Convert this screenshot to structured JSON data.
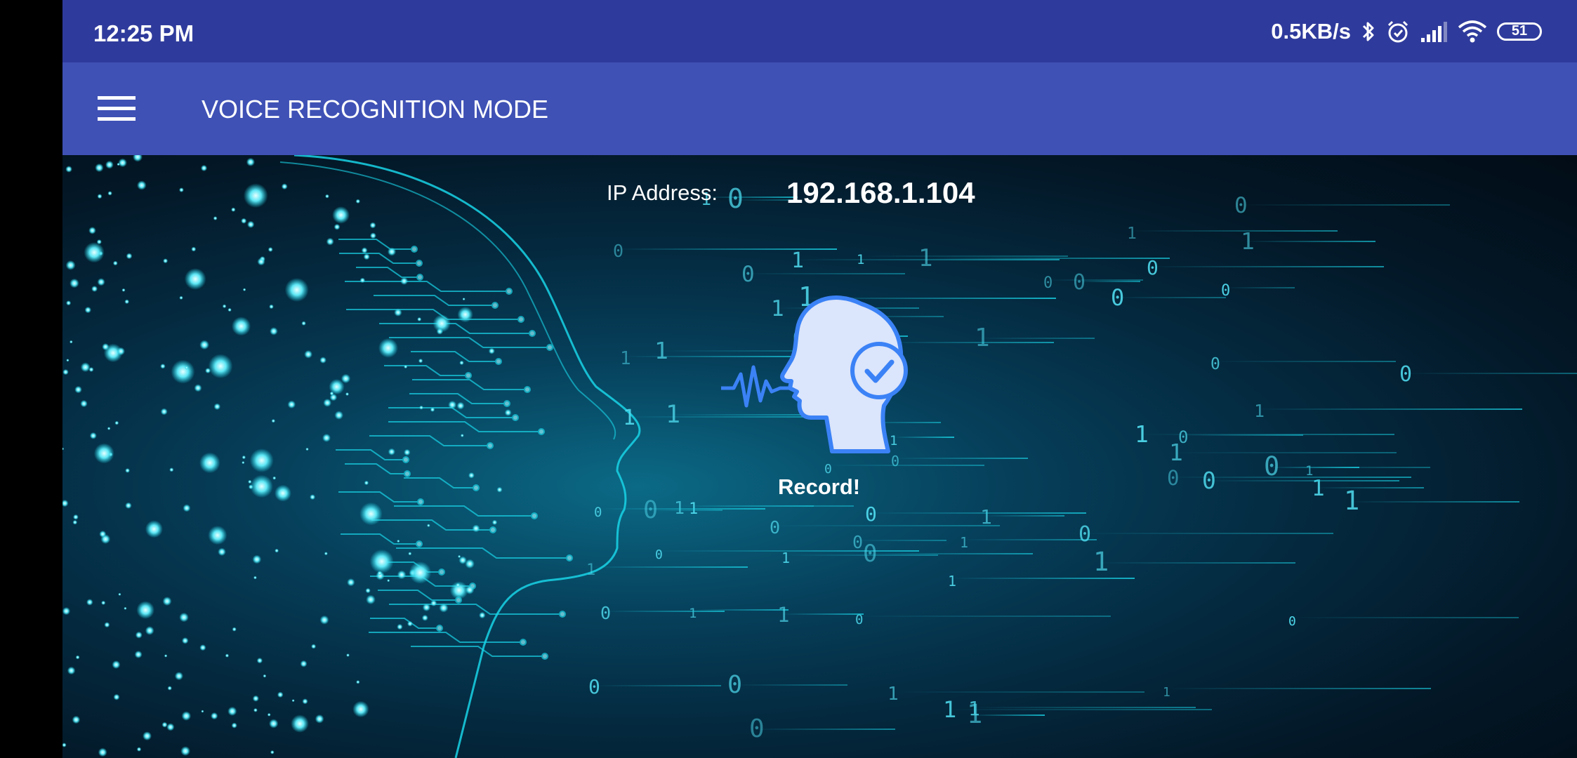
{
  "status_bar": {
    "time": "12:25 PM",
    "network_speed": "0.5KB/s",
    "battery_level": "51",
    "icons": [
      "bluetooth-icon",
      "alarm-icon",
      "signal-icon",
      "wifi-icon",
      "battery-icon"
    ]
  },
  "app_bar": {
    "title": "VOICE RECOGNITION MODE",
    "menu_icon": "hamburger-menu-icon",
    "color": "#3f51b5"
  },
  "main": {
    "ip_label": "IP Address:",
    "ip_value": "192.168.1.104",
    "record_label": "Record!",
    "record_icon": "voice-recognition-head-icon"
  },
  "colors": {
    "status_bar": "#2f3b9c",
    "app_bar": "#3f51b5",
    "accent_cyan": "#19d3e6",
    "icon_blue": "#3b82f6"
  }
}
